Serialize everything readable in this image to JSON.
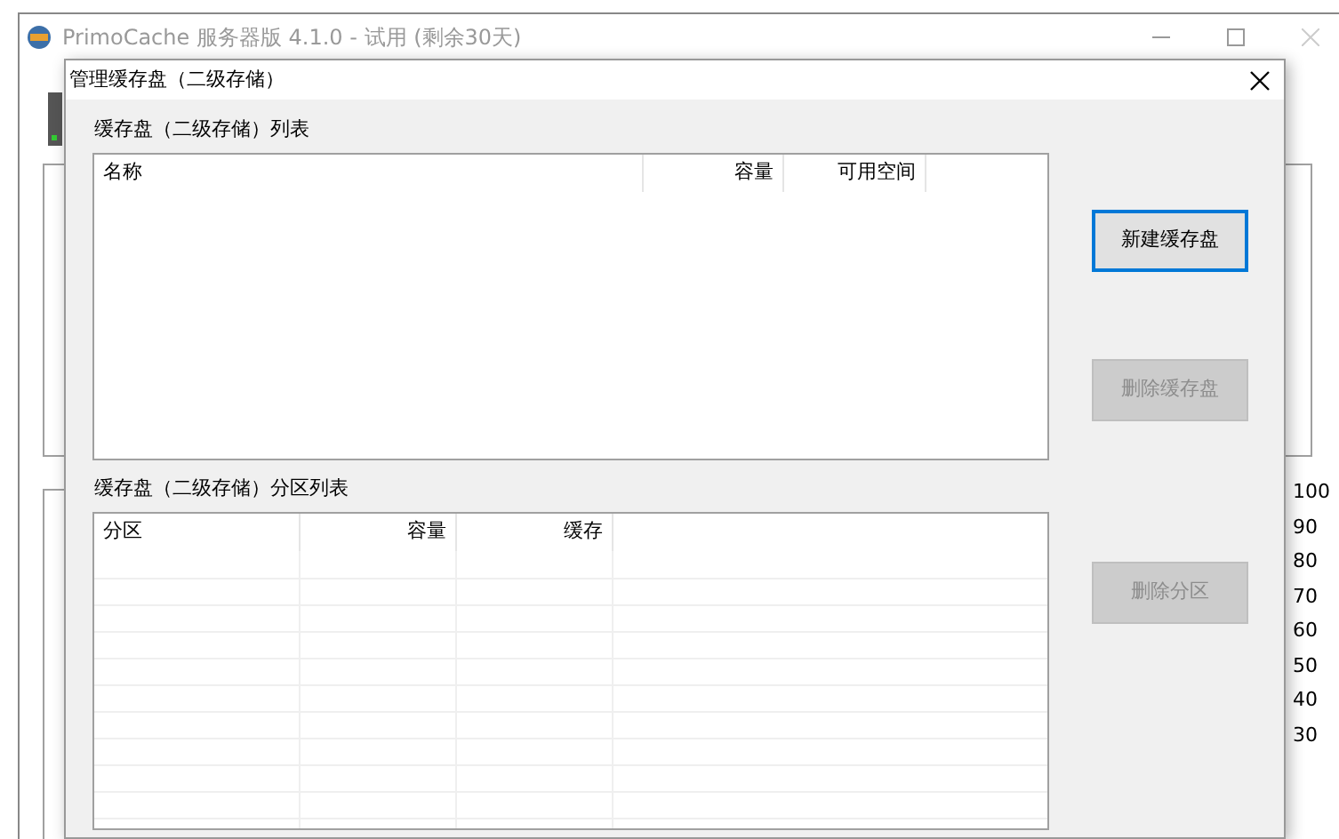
{
  "main_window": {
    "title": "PrimoCache 服务器版 4.1.0 - 试用 (剩余30天)",
    "axis_labels": [
      "100",
      "90",
      "80",
      "70",
      "60",
      "50",
      "40",
      "30"
    ]
  },
  "dialog": {
    "title": "管理缓存盘（二级存储）",
    "disk_list": {
      "label": "缓存盘（二级存储）列表",
      "columns": [
        "名称",
        "容量",
        "可用空间"
      ]
    },
    "partition_list": {
      "label": "缓存盘（二级存储）分区列表",
      "columns": [
        "分区",
        "容量",
        "缓存"
      ]
    },
    "buttons": [
      {
        "label": "新建缓存盘",
        "disabled": false,
        "focused": true
      },
      {
        "label": "删除缓存盘",
        "disabled": true,
        "focused": false
      },
      {
        "label": "删除分区",
        "disabled": true,
        "focused": false
      }
    ]
  }
}
